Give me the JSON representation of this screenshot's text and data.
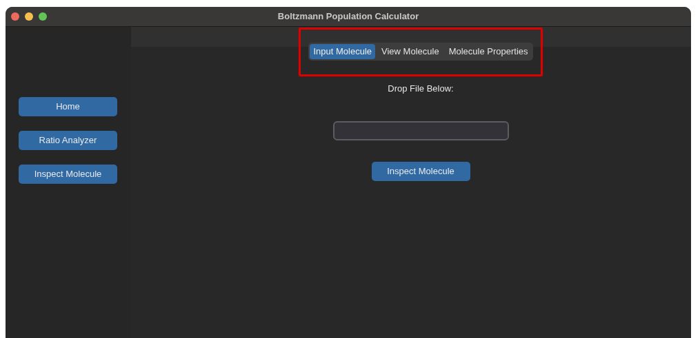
{
  "window": {
    "title": "Boltzmann Population Calculator"
  },
  "sidebar": {
    "buttons": [
      "Home",
      "Ratio Analyzer",
      "Inspect Molecule"
    ]
  },
  "tabs": [
    {
      "label": "Input Molecule",
      "selected": true
    },
    {
      "label": "View Molecule",
      "selected": false
    },
    {
      "label": "Molecule Properties",
      "selected": false
    }
  ],
  "prompt": "Drop File Below:",
  "action_button": "Inspect Molecule"
}
